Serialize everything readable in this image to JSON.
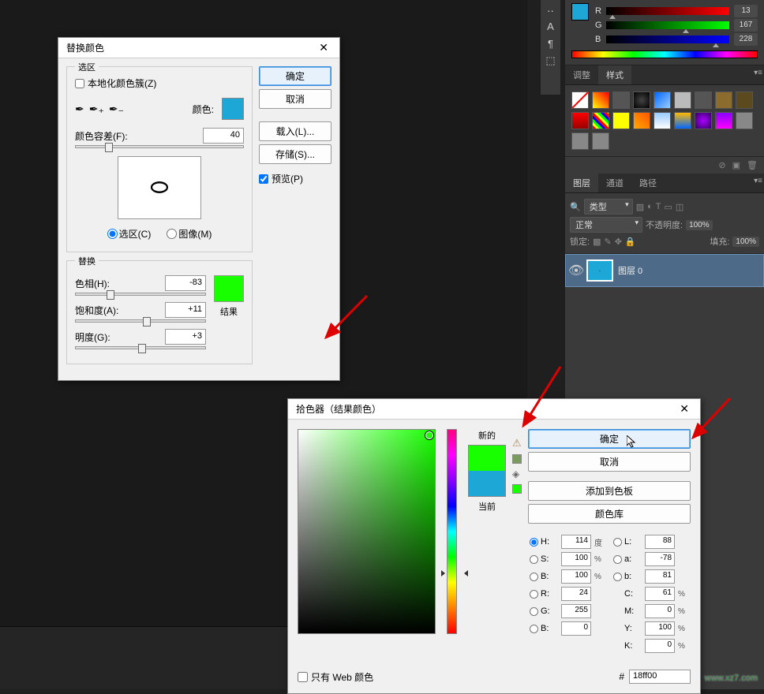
{
  "rgb": {
    "r_label": "R",
    "g_label": "G",
    "b_label": "B",
    "r": "13",
    "g": "167",
    "b": "228",
    "r_pos": "5%",
    "g_pos": "65%",
    "b_pos": "89%"
  },
  "panels": {
    "adjust": "调整",
    "styles": "样式",
    "layers": "图层",
    "channels": "通道",
    "paths": "路径"
  },
  "swatches": [
    "none",
    "linear-gradient(45deg,#ff0,#f00)",
    "#555",
    "radial-gradient(#444,#000)",
    "linear-gradient(135deg,#06f,#9cf)",
    "#bbb",
    "#555",
    "#8c6b2f",
    "#5c4a1f",
    "linear-gradient(#f00,#900)",
    "repeating-linear-gradient(45deg,#f00 0 3px,#ff0 3px 6px,#0f0 6px 9px,#00f 9px 12px)",
    "#ff0",
    "linear-gradient(45deg,#fa0,#f50)",
    "linear-gradient(#9cf,#fff)",
    "linear-gradient(#fb0,#06f)",
    "radial-gradient(#a0f,#306)",
    "linear-gradient(#80f,#f0f)",
    "#888",
    "#888",
    "#888"
  ],
  "layers_panel": {
    "kind": "类型",
    "blend": "正常",
    "opacity_lbl": "不透明度:",
    "opacity_val": "100%",
    "lock_lbl": "锁定:",
    "fill_lbl": "填充:",
    "fill_val": "100%",
    "layer0": "图层 0"
  },
  "dialog1": {
    "title": "替换颜色",
    "selection_group": "选区",
    "local_clusters": "本地化颜色簇(Z)",
    "color_label": "颜色:",
    "fuzz_label": "颜色容差(F):",
    "fuzz_val": "40",
    "sel_radio": "选区(C)",
    "img_radio": "图像(M)",
    "replace_group": "替换",
    "hue_label": "色相(H):",
    "hue_val": "-83",
    "sat_label": "饱和度(A):",
    "sat_val": "+11",
    "lig_label": "明度(G):",
    "lig_val": "+3",
    "result_label": "结果",
    "ok": "确定",
    "cancel": "取消",
    "load": "载入(L)...",
    "save": "存储(S)...",
    "preview": "预览(P)",
    "color_swatch": "#1da7d6",
    "result_swatch": "#18ff00"
  },
  "dialog2": {
    "title": "拾色器（结果颜色）",
    "new_label": "新的",
    "old_label": "当前",
    "ok": "确定",
    "cancel": "取消",
    "add": "添加到色板",
    "lib": "颜色库",
    "H": "H:",
    "S": "S:",
    "B": "B:",
    "R": "R:",
    "G": "G:",
    "Bb": "B:",
    "L": "L:",
    "a": "a:",
    "b": "b:",
    "C": "C:",
    "M": "M:",
    "Y": "Y:",
    "K": "K:",
    "H_v": "114",
    "S_v": "100",
    "B_v": "100",
    "R_v": "24",
    "G_v": "255",
    "Bb_v": "0",
    "L_v": "88",
    "a_v": "-78",
    "b_v": "81",
    "C_v": "61",
    "M_v": "0",
    "Y_v": "100",
    "K_v": "0",
    "deg": "度",
    "pct": "%",
    "hex_label": "#",
    "hex": "18ff00",
    "web": "只有 Web 颜色"
  },
  "watermark": "www.xz7.com"
}
